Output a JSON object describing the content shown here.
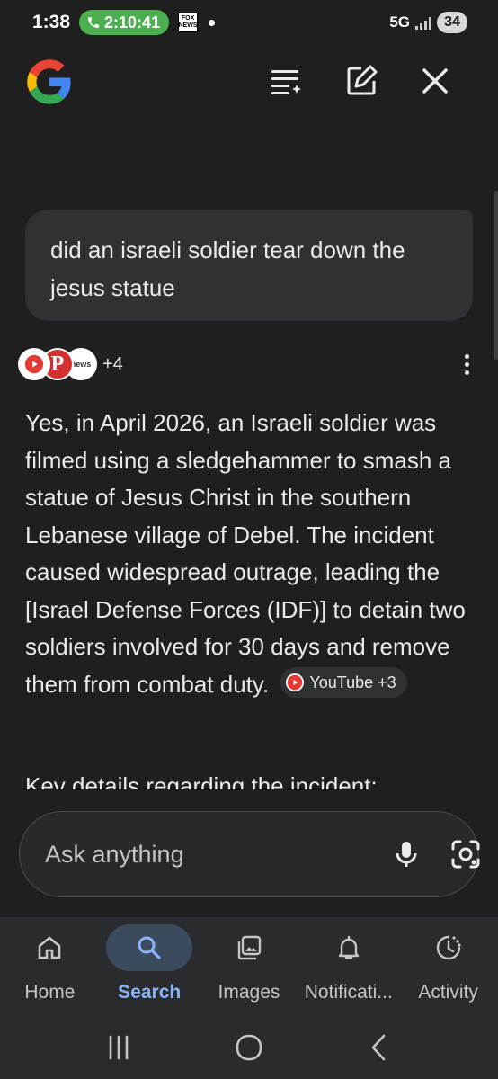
{
  "status_bar": {
    "time": "1:38",
    "call_timer": "2:10:41",
    "fox_badge_line1": "FOX",
    "fox_badge_line2": "NEWS",
    "network": "5G",
    "battery": "34"
  },
  "header": {
    "logo_letter": "G",
    "icons": [
      "search-history-icon",
      "new-chat-icon",
      "close-icon"
    ]
  },
  "conversation": {
    "query": "did an israeli soldier tear down the jesus statue",
    "sources_more": "+4",
    "source_news_label": "news",
    "source_p_label": "P",
    "answer": "Yes, in April 2026, an Israeli soldier was filmed using a sledgehammer to smash a statue of Jesus Christ in the southern Lebanese village of Debel. The incident caused widespread outrage, leading the [Israel Defense Forces (IDF)] to detain two soldiers involved for 30 days and remove them from combat duty.",
    "citation_chip": "YouTube +3",
    "key_details_heading": "Key details regarding the incident:"
  },
  "ask_bar": {
    "placeholder": "Ask anything",
    "icons": [
      "mic-icon",
      "lens-icon"
    ]
  },
  "bottom_nav": {
    "items": [
      {
        "label": "Home",
        "icon": "home-icon",
        "active": false
      },
      {
        "label": "Search",
        "icon": "search-icon",
        "active": true
      },
      {
        "label": "Images",
        "icon": "images-icon",
        "active": false
      },
      {
        "label": "Notificati...",
        "icon": "bell-icon",
        "active": false
      },
      {
        "label": "Activity",
        "icon": "activity-icon",
        "active": false
      }
    ]
  },
  "colors": {
    "background": "#1f1f1f",
    "bubble": "#303134",
    "accent": "#8ab4f8",
    "call_pill": "#4caf50"
  }
}
